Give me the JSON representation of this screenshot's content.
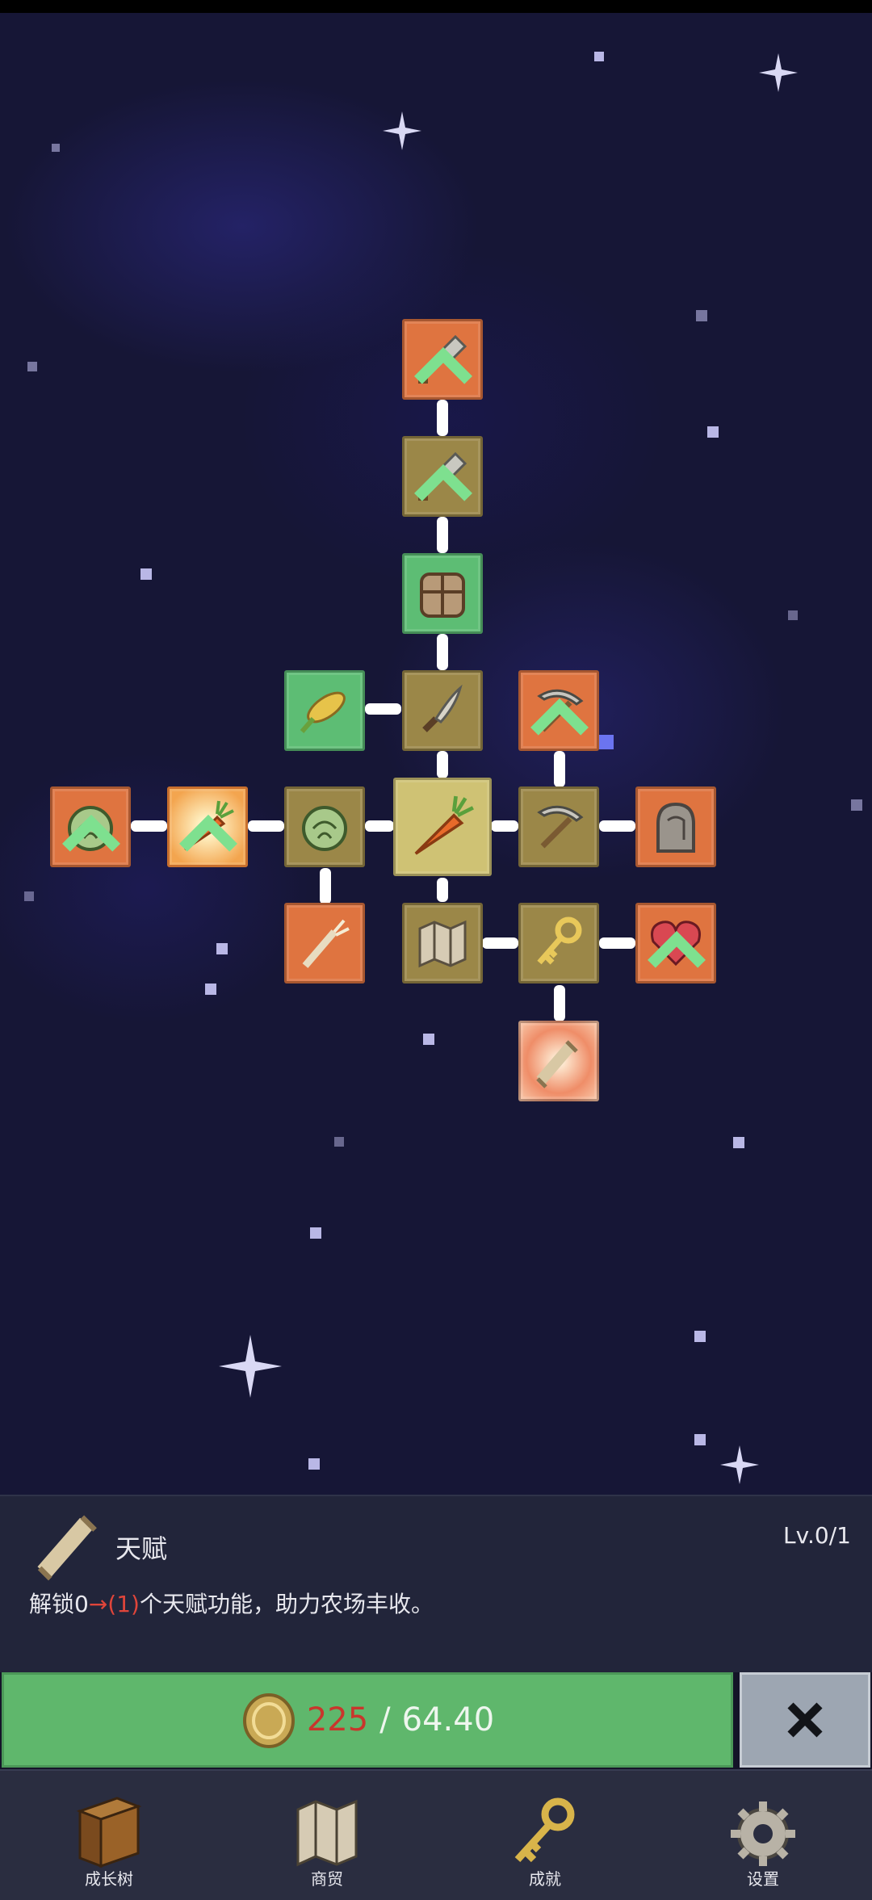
{
  "talent_tree": {
    "nodes": [
      {
        "id": "shovel-upgrade-top",
        "icon": "shovel-icon",
        "color": "orange",
        "upgradable": true
      },
      {
        "id": "shovel-upgrade",
        "icon": "shovel-icon",
        "color": "gold",
        "upgradable": true
      },
      {
        "id": "backpack",
        "icon": "backpack-icon",
        "color": "green",
        "upgradable": false
      },
      {
        "id": "corn",
        "icon": "corn-icon",
        "color": "green",
        "upgradable": false
      },
      {
        "id": "sickle",
        "icon": "sickle-icon",
        "color": "gold",
        "upgradable": false
      },
      {
        "id": "pickaxe-upgrade",
        "icon": "pickaxe-icon",
        "color": "orange",
        "upgradable": true
      },
      {
        "id": "cabbage-upgrade-far",
        "icon": "cabbage-icon",
        "color": "orange",
        "upgradable": true
      },
      {
        "id": "carrot-upgrade",
        "icon": "carrot-icon",
        "color": "glow",
        "upgradable": true
      },
      {
        "id": "cabbage",
        "icon": "cabbage-icon",
        "color": "gold",
        "upgradable": false
      },
      {
        "id": "carrot-root",
        "icon": "carrot-icon",
        "color": "center",
        "upgradable": false
      },
      {
        "id": "pickaxe",
        "icon": "pickaxe-icon",
        "color": "gold",
        "upgradable": false
      },
      {
        "id": "ghost",
        "icon": "ghost-icon",
        "color": "orange",
        "upgradable": false
      },
      {
        "id": "wheat",
        "icon": "wheat-icon",
        "color": "orange",
        "upgradable": false
      },
      {
        "id": "map",
        "icon": "map-icon",
        "color": "gold",
        "upgradable": false
      },
      {
        "id": "key",
        "icon": "key-icon",
        "color": "gold",
        "upgradable": false
      },
      {
        "id": "heart-upgrade",
        "icon": "heart-icon",
        "color": "orange",
        "upgradable": true
      },
      {
        "id": "scroll-talent",
        "icon": "scroll-icon",
        "color": "burst",
        "upgradable": false
      }
    ]
  },
  "detail": {
    "icon": "scroll-icon",
    "name": "天赋",
    "level": "Lv.0/1",
    "desc_prefix": "解锁0",
    "desc_arrow": "→",
    "desc_highlight": "(1)",
    "desc_suffix": "个天赋功能，助力农场丰收。"
  },
  "purchase": {
    "coin_icon": "coin-icon",
    "current": "225",
    "separator": "/",
    "total": "64.40",
    "close_icon": "close-icon"
  },
  "nav": {
    "items": [
      {
        "label": "成长树",
        "icon": "book-icon"
      },
      {
        "label": "商贸",
        "icon": "map-icon"
      },
      {
        "label": "成就",
        "icon": "key-icon"
      },
      {
        "label": "设置",
        "icon": "gear-icon"
      }
    ]
  },
  "colors": {
    "orange": "#df7440",
    "gold": "#9b8748",
    "green": "#5dbd74",
    "center": "#cfc274",
    "button_green": "#5fb76c",
    "price_red": "#c9362c",
    "panel": "#22253a"
  }
}
